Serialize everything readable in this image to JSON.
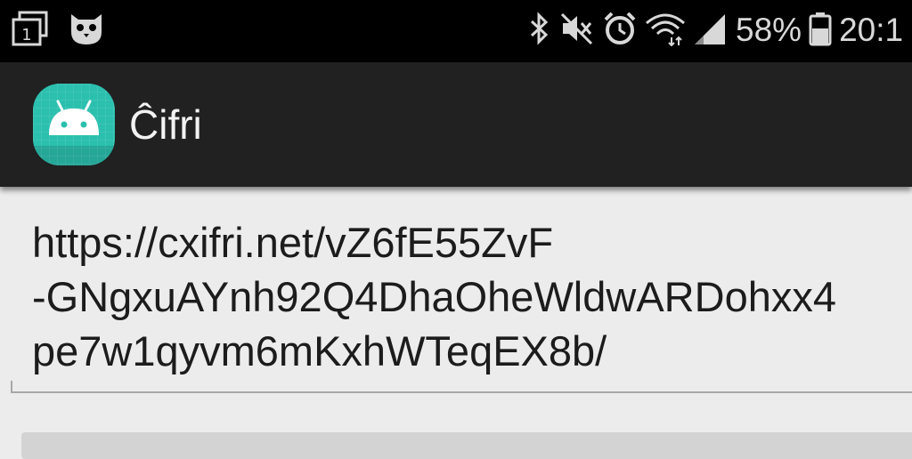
{
  "status_bar": {
    "battery_percent": "58%",
    "time": "20:1",
    "icons": [
      "recent-apps-icon",
      "owl-notification-icon",
      "bluetooth-icon",
      "mute-icon",
      "alarm-icon",
      "wifi-icon",
      "signal-icon",
      "battery-icon"
    ],
    "recent_badge": "1"
  },
  "app_bar": {
    "title": "Ĉifri",
    "icon": "android-icon",
    "icon_color": "#2bbfae"
  },
  "content": {
    "url_lines": [
      "https://cxifri.net/vZ6fE55ZvF",
      "-GNgxuAYnh92Q4DhaOheWldwARDohxx4",
      "pe7w1qyvm6mKxhWTeqEX8b/"
    ]
  }
}
